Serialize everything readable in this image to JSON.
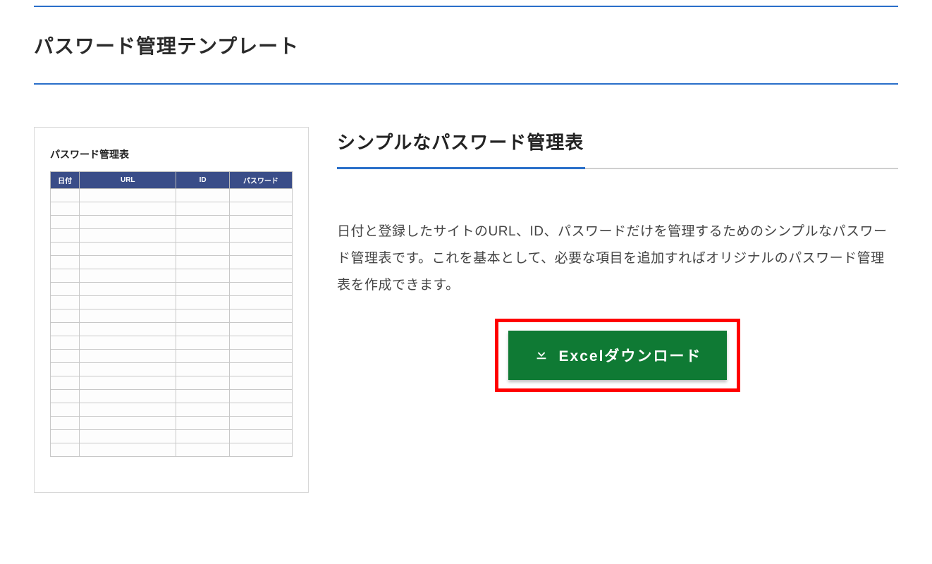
{
  "page": {
    "title": "パスワード管理テンプレート"
  },
  "preview": {
    "title": "パスワード管理表",
    "columns": [
      "日付",
      "URL",
      "ID",
      "パスワード"
    ],
    "empty_rows": 20
  },
  "section": {
    "title": "シンプルなパスワード管理表",
    "description": "日付と登録したサイトのURL、ID、パスワードだけを管理するためのシンプルなパスワード管理表です。これを基本として、必要な項目を追加すればオリジナルのパスワード管理表を作成できます。"
  },
  "actions": {
    "download_label": "Excelダウンロード"
  },
  "colors": {
    "accent_blue": "#2a6fc9",
    "button_green": "#0f7a34",
    "highlight_red": "#ff0000",
    "table_header": "#3a4d88"
  }
}
